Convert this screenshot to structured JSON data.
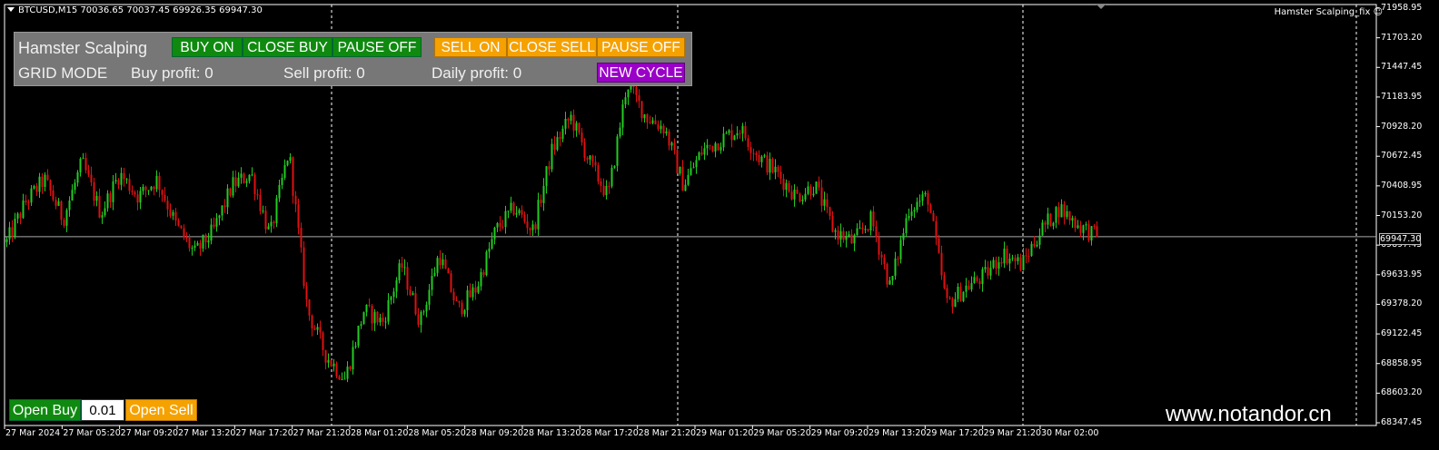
{
  "header": {
    "symbol_info": "BTCUSD,M15  70036.65 70037.45 69926.35 69947.30",
    "ea_name": "Hamster Scalping_fix"
  },
  "price_axis": {
    "ticks": [
      "71958.95",
      "71703.20",
      "71447.45",
      "71183.95",
      "70928.20",
      "70672.45",
      "70408.95",
      "70153.20",
      "69897.45",
      "69633.95",
      "69378.20",
      "69122.45",
      "68858.95",
      "68603.20",
      "68347.45"
    ],
    "current_price": "69947.30"
  },
  "time_axis": {
    "ticks": [
      "27 Mar 2024",
      "27 Mar 05:20",
      "27 Mar 09:20",
      "27 Mar 13:20",
      "27 Mar 17:20",
      "27 Mar 21:20",
      "28 Mar 01:20",
      "28 Mar 05:20",
      "28 Mar 09:20",
      "28 Mar 13:20",
      "28 Mar 17:20",
      "28 Mar 21:20",
      "29 Mar 01:20",
      "29 Mar 05:20",
      "29 Mar 09:20",
      "29 Mar 13:20",
      "29 Mar 17:20",
      "29 Mar 21:20",
      "30 Mar 02:00"
    ]
  },
  "panel": {
    "title": "Hamster Scalping",
    "mode": "GRID MODE",
    "buy_profit": "Buy profit: 0",
    "sell_profit": "Sell profit: 0",
    "daily_profit": "Daily profit: 0",
    "buttons": {
      "buy_on": "BUY ON",
      "close_buy": "CLOSE BUY",
      "pause_off_buy": "PAUSE OFF",
      "sell_on": "SELL ON",
      "close_sell": "CLOSE SELL",
      "pause_off_sell": "PAUSE OFF",
      "new_cycle": "NEW CYCLE"
    }
  },
  "trade": {
    "open_buy": "Open Buy",
    "lot": "0.01",
    "open_sell": "Open Sell"
  },
  "watermark": "www.notandor.cn",
  "colors": {
    "bull": "#22cc22",
    "bear": "#e01010",
    "green_btn": "#0f8a0f",
    "orange_btn": "#f5a100",
    "purple_btn": "#9a00c8"
  },
  "chart_data": {
    "type": "candlestick",
    "symbol": "BTCUSD",
    "timeframe": "M15",
    "ylim": [
      68347.45,
      71958.95
    ],
    "last_close": 69947.3,
    "trend_closes": [
      69900,
      70250,
      70450,
      70100,
      70600,
      70150,
      70500,
      70300,
      70450,
      70050,
      69800,
      70000,
      70400,
      70500,
      69950,
      70700,
      69300,
      68900,
      68700,
      69300,
      69200,
      69700,
      69200,
      69800,
      69300,
      69500,
      70000,
      70200,
      70000,
      70700,
      71000,
      70600,
      70300,
      71300,
      71000,
      70900,
      70400,
      70700,
      70800,
      70900,
      70650,
      70500,
      70300,
      70400,
      70000,
      69900,
      70100,
      69500,
      70200,
      70300,
      69350,
      69500,
      69600,
      69800,
      69700,
      70000,
      70200,
      70050,
      69950
    ]
  }
}
